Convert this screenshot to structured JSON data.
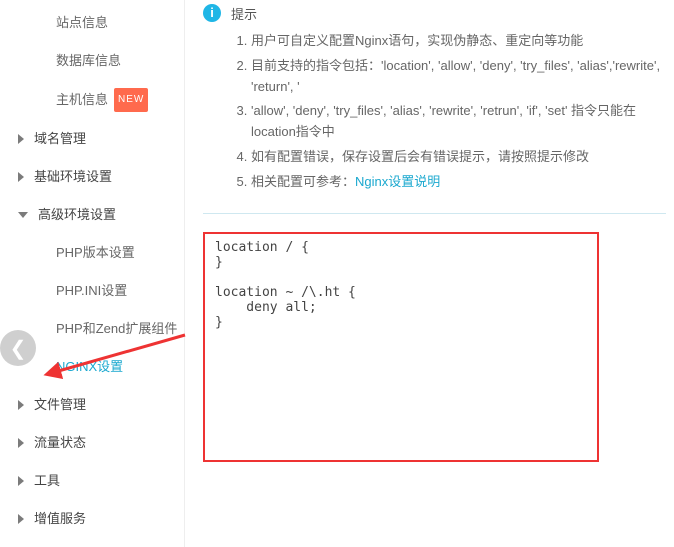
{
  "sidebar": {
    "items": [
      {
        "label": "站点信息",
        "kind": "sub"
      },
      {
        "label": "数据库信息",
        "kind": "sub"
      },
      {
        "label": "主机信息",
        "kind": "sub",
        "new": "NEW"
      },
      {
        "label": "域名管理",
        "kind": "collapsed"
      },
      {
        "label": "基础环境设置",
        "kind": "collapsed"
      },
      {
        "label": "高级环境设置",
        "kind": "expanded"
      },
      {
        "label": "PHP版本设置",
        "kind": "sub2"
      },
      {
        "label": "PHP.INI设置",
        "kind": "sub2"
      },
      {
        "label": "PHP和Zend扩展组件",
        "kind": "sub2"
      },
      {
        "label": "NGINX设置",
        "kind": "sub2",
        "active": true
      },
      {
        "label": "文件管理",
        "kind": "collapsed"
      },
      {
        "label": "流量状态",
        "kind": "collapsed"
      },
      {
        "label": "工具",
        "kind": "collapsed"
      },
      {
        "label": "增值服务",
        "kind": "collapsed"
      }
    ]
  },
  "tip": {
    "title": "提示",
    "lines": {
      "l1": "用户可自定义配置Nginx语句，实现伪静态、重定向等功能",
      "l2": "目前支持的指令包括：'location', 'allow', 'deny', 'try_files', 'alias','rewrite', 'return', '",
      "l3": "'allow', 'deny', 'try_files', 'alias', 'rewrite', 'retrun', 'if', 'set' 指令只能在location指令中",
      "l4": "如有配置错误，保存设置后会有错误提示，请按照提示修改",
      "l5a": "相关配置可参考：",
      "l5b": "Nginx设置说明"
    }
  },
  "editor": {
    "content": "location / {\n}\n\nlocation ~ /\\.ht {\n    deny all;\n}"
  }
}
